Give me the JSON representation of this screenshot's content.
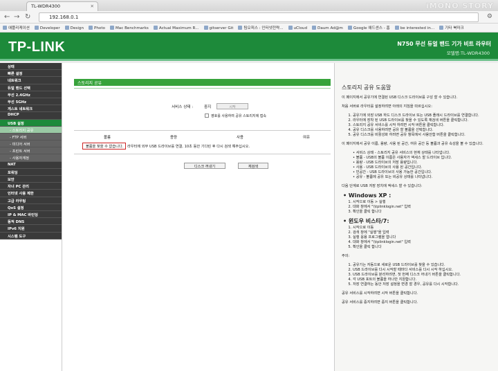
{
  "browser": {
    "tab_title": "TL-WDR4300",
    "watermark": "iMONO STORY",
    "url": "192.168.0.1",
    "bookmarks": [
      "애플리케이션",
      "Developer",
      "Design",
      "Photo",
      "Mac Benchmarks",
      "Actual Maximum R...",
      "gitserver Git",
      "팀오피스 : 인터넷전략...",
      "uCloud",
      "Daum Ad@m",
      "Google 애드센스 - 홈",
      "be interested in...",
      "기타 북마크"
    ]
  },
  "header": {
    "logo": "TP-LINK",
    "product": "N750 무선 듀얼 밴드 기가 비트 라우터",
    "model": "모델명:TL-WDR4300"
  },
  "sidebar": {
    "items": [
      {
        "label": "상태",
        "type": "main"
      },
      {
        "label": "빠른 설정",
        "type": "main"
      },
      {
        "label": "네트워크",
        "type": "main"
      },
      {
        "label": "듀얼 밴드 선택",
        "type": "main"
      },
      {
        "label": "무선 2.4GHz",
        "type": "main"
      },
      {
        "label": "무선 5GHz",
        "type": "main"
      },
      {
        "label": "게스트 네트워크",
        "type": "main"
      },
      {
        "label": "DHCP",
        "type": "main"
      },
      {
        "label": "USB 설정",
        "type": "active"
      },
      {
        "label": "- 스토리지 공유",
        "type": "subactive"
      },
      {
        "label": "- FTP 서버",
        "type": "sub"
      },
      {
        "label": "- 미디어 서버",
        "type": "sub"
      },
      {
        "label": "- 프린트 서버",
        "type": "sub"
      },
      {
        "label": "- 사용자계정",
        "type": "sub"
      },
      {
        "label": "NAT",
        "type": "main"
      },
      {
        "label": "포워딩",
        "type": "main"
      },
      {
        "label": "보안",
        "type": "main"
      },
      {
        "label": "자녀 PC 관리",
        "type": "main"
      },
      {
        "label": "인터넷 사용 제한",
        "type": "main"
      },
      {
        "label": "고급 라우팅",
        "type": "main"
      },
      {
        "label": "QoS 설정",
        "type": "main"
      },
      {
        "label": "IP & MAC 바인딩",
        "type": "main"
      },
      {
        "label": "동적 DNS",
        "type": "main"
      },
      {
        "label": "IPv6 지원",
        "type": "main"
      },
      {
        "label": "시스템 도구",
        "type": "main"
      }
    ]
  },
  "main": {
    "section_title": "스토리지 공유",
    "service_label": "서비스 상태 :",
    "service_value": "중지",
    "start_button": "시작",
    "checkbox_label": "영호를 사용하여 공유 스토리지에 접속",
    "columns": [
      "볼륨",
      "용량",
      "사용",
      "여유"
    ],
    "message_box": "볼륨을 찾을 수 없습니다.",
    "message_rest": "라우터에 외부 USB 드라이브를 연결, 10초 동안 기다린 후 다시 검색 해주십시오.",
    "button_rescan": "디스크 꺼내기",
    "button_scan": "재검색"
  },
  "help": {
    "title": "스토리지 공유 도움말",
    "intro": "이 페이지에서 공유기에 연결된 USB 디스크 드라이브를 구성 할 수 있습니다.",
    "p1": "처음 서버로 라우터를 설정하려면 아래의 지침을 따르십시오:",
    "list1": [
      "공유기에 외장 USB 하드 디스크 드라이브 또는 USB 플래시 드라이브를 연결합니다.",
      "라우터에 장착 된 USB 드라이브를 찾을 수 있도록 재검색 버튼을 클릭합니다.",
      "스토리지 공유 서비스를 시작 하려면 시작 버튼을 클릭합니다.",
      "공유 디스크를 사용하려면 공유 할 볼륨을 선택합니다.",
      "공유 디스크를 비활성화 하려면 공유 항목에서 사용안함 버튼을 클릭합니다."
    ],
    "p2": "이 페이지에서 공유 이름, 용량, 사용 된 공간, 여유 공간 등 볼륨과 공유 속성을 볼 수 있습니다.",
    "list2": [
      "서비스 상태 - 스토리지 공유 서비스의 현재 상태를 나타냅니다.",
      "볼륨 - USB의 볼륨 이름은 사용자가 액세스 할 드라이브 입니다.",
      "용량 - USB 드라이브의 저장 용량입니다.",
      "사용 - USB 드라이브의 사용 된 공간입니다.",
      "빈공간 - USB 드라이브의 사용 가능한 공간입니다.",
      "공유 - 볼륨에 공유 또는 비공유 상태를 나타냅니다."
    ],
    "p3": "다음 단계로 USB 저장 장치에 액세스 할 수 있습니다:",
    "xp": "Windows XP :",
    "list3": [
      "시작으로 이동 > 실행",
      "대화 창에서 \"\\\\tplinklogin.net\" 입력",
      "확인을 클릭 합니다"
    ],
    "vista": "윈도우 비스타/7:",
    "list4": [
      "시작으로 이동",
      "검색 창에 \"실행\"을 입력",
      "실행 응용 프로그램을 엽니다",
      "대화 창에서 \"\\\\tplinklogin.net\" 입력",
      "확인을 클릭 합니다"
    ],
    "note": "주의:",
    "list5": [
      "공유기는 자동으로 새로운 USB 드라이브를 찾을 수 있습니다.",
      "USB 드라이브를 다시 시작할 때마다 서비스를 다시 시작 하십시오.",
      "USB 드라이브를 분리하려면, 첫 번째 디스크 꺼내기 버튼을 클릭합니다.",
      "각 USB 포트의 볼륨을 하나만 지원합니다.",
      "저장 연결하는 동안 저장 설정을 변경 할 경우, 공유를 다시 시작합니다."
    ],
    "end1": "공유 서비스를 시작하려면 시작 버튼을 클릭합니다.",
    "end2": "공유 서비스를 중지하려면 중지 버튼을 클릭합니다."
  }
}
